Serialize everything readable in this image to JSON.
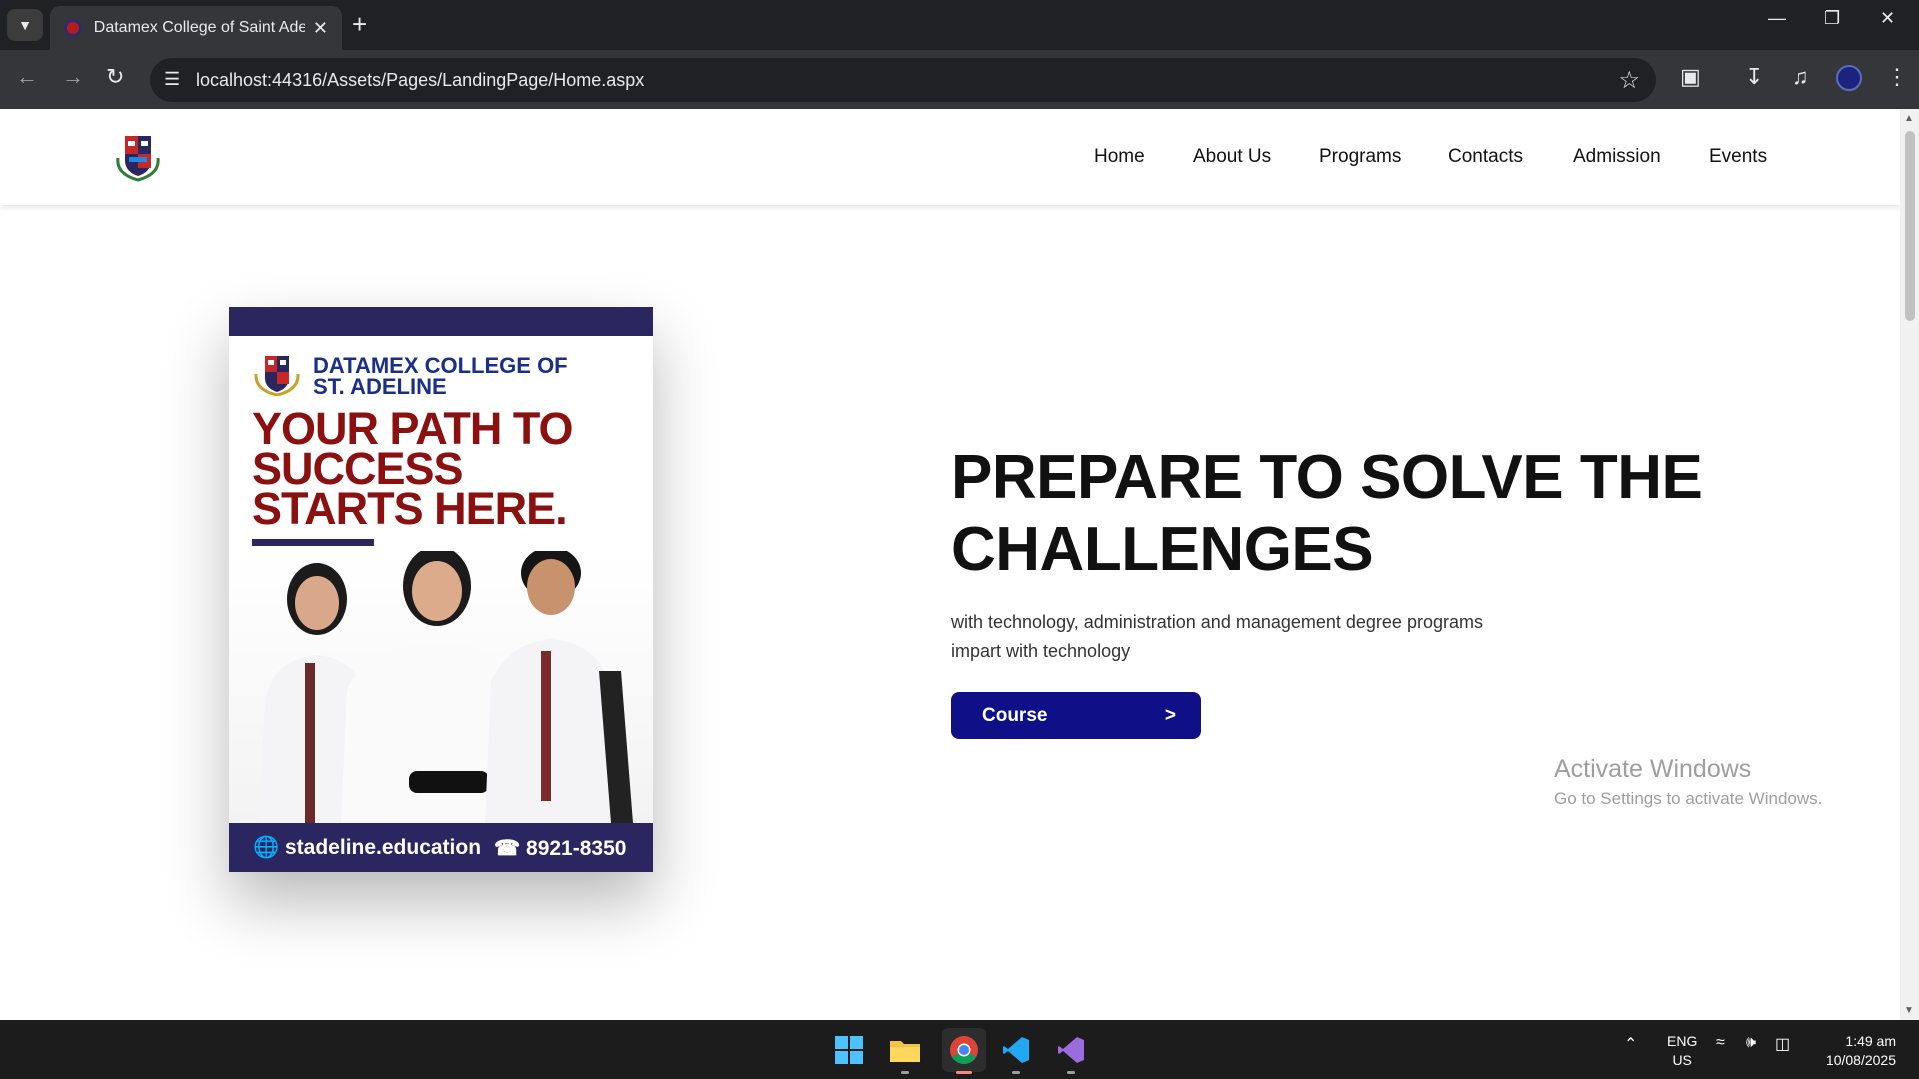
{
  "browser": {
    "tab_title": "Datamex College of Saint Adeline",
    "url": "localhost:44316/Assets/Pages/LandingPage/Home.aspx",
    "icons": {
      "tab_menu": "chevron-down-icon",
      "close": "close-icon",
      "new_tab": "plus-icon",
      "back": "back-arrow-icon",
      "forward": "forward-arrow-icon",
      "reload": "reload-icon",
      "site_info": "site-info-icon",
      "bookmark": "star-icon",
      "extensions": "puzzle-icon",
      "download": "download-icon",
      "media": "media-control-icon",
      "menu": "more-vert-icon"
    }
  },
  "site": {
    "nav": [
      "Home",
      "About Us",
      "Programs",
      "Contacts",
      "Admission",
      "Events"
    ],
    "poster": {
      "college_line1": "DATAMEX COLLEGE OF",
      "college_line2": "ST. ADELINE",
      "tag_line1": "YOUR PATH TO",
      "tag_line2": "SUCCESS",
      "tag_line3": "STARTS HERE.",
      "website": "stadeline.education",
      "phone": "8921-8350"
    },
    "hero": {
      "title_line1": "PREPARE TO SOLVE THE",
      "title_line2": "CHALLENGES",
      "subtitle_line1": "with technology, administration and management degree programs",
      "subtitle_line2": "impart with technology"
    },
    "course_button": {
      "label": "Course",
      "arrow": ">"
    }
  },
  "watermark": {
    "line1": "Activate Windows",
    "line2": "Go to Settings to activate Windows."
  },
  "taskbar": {
    "lang_line1": "ENG",
    "lang_line2": "US",
    "time": "1:49 am",
    "date": "10/08/2025"
  },
  "colors": {
    "brand_navy": "#2b2560",
    "button_blue": "#0f0f87",
    "poster_red": "#8b1010",
    "poster_blue": "#1a2f8a"
  }
}
